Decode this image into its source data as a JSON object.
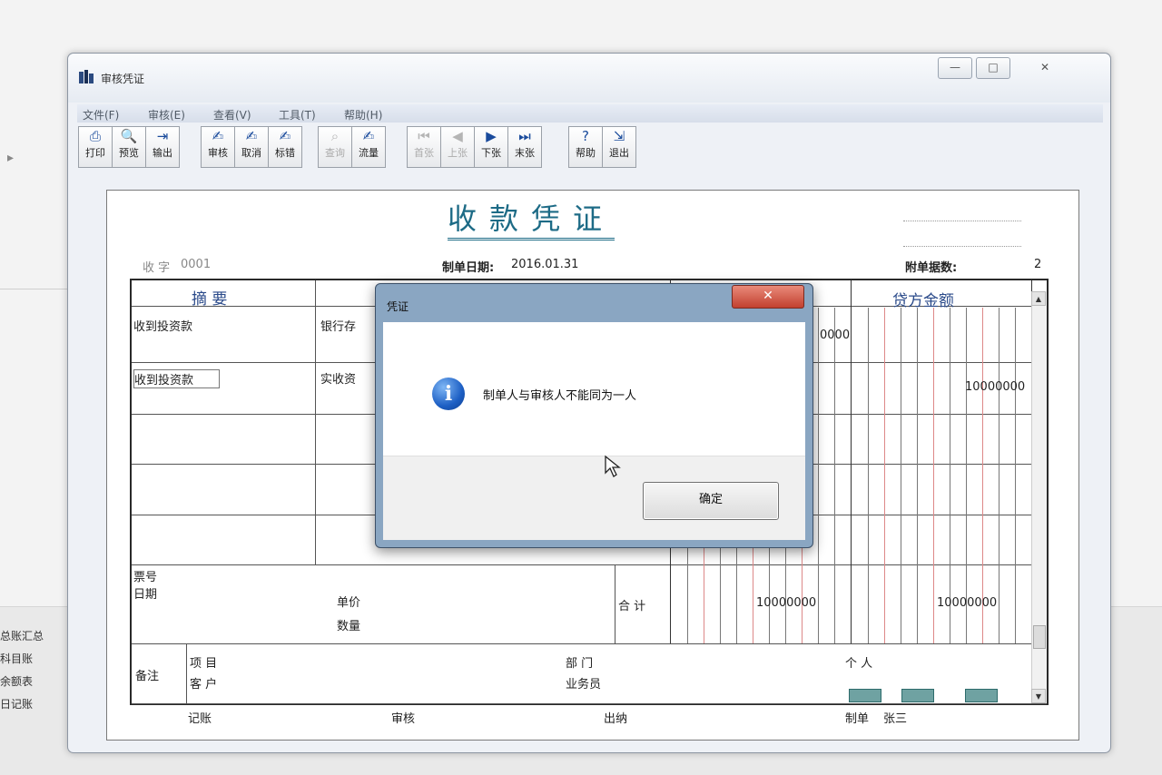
{
  "background": {
    "left_items": [
      "总账汇总",
      "科目账",
      "余额表",
      "日记账"
    ],
    "arrow": "▸"
  },
  "window": {
    "title": "审核凭证",
    "controls": {
      "minimize": "—",
      "maximize": "□",
      "close": "✕"
    },
    "menu": [
      "文件(F)",
      "审核(E)",
      "查看(V)",
      "工具(T)",
      "帮助(H)"
    ],
    "toolbar": [
      {
        "label": "打印",
        "icon": "printer-icon",
        "glyph": "⎙",
        "enabled": true
      },
      {
        "label": "预览",
        "icon": "preview-icon",
        "glyph": "🔍",
        "enabled": true
      },
      {
        "label": "输出",
        "icon": "export-icon",
        "glyph": "⇥",
        "enabled": true
      },
      {
        "label": "审核",
        "icon": "audit-icon",
        "glyph": "✍",
        "enabled": true
      },
      {
        "label": "取消",
        "icon": "cancel-icon",
        "glyph": "✍",
        "enabled": true
      },
      {
        "label": "标错",
        "icon": "mark-error-icon",
        "glyph": "✍",
        "enabled": true
      },
      {
        "label": "查询",
        "icon": "query-icon",
        "glyph": "⌕",
        "enabled": false
      },
      {
        "label": "流量",
        "icon": "flow-icon",
        "glyph": "✍",
        "enabled": true
      },
      {
        "label": "首张",
        "icon": "first-icon",
        "glyph": "⏮",
        "enabled": false
      },
      {
        "label": "上张",
        "icon": "prev-icon",
        "glyph": "◀",
        "enabled": false
      },
      {
        "label": "下张",
        "icon": "next-icon",
        "glyph": "▶",
        "enabled": true
      },
      {
        "label": "末张",
        "icon": "last-icon",
        "glyph": "⏭",
        "enabled": true
      },
      {
        "label": "帮助",
        "icon": "help-icon",
        "glyph": "?",
        "enabled": true
      },
      {
        "label": "退出",
        "icon": "exit-icon",
        "glyph": "⇲",
        "enabled": true
      }
    ]
  },
  "voucher": {
    "title": "收款凭证",
    "type_label": "收 字",
    "number": "0001",
    "date_label": "制单日期:",
    "date": "2016.01.31",
    "attach_label": "附单据数:",
    "attach_count": "2",
    "col_summary": "摘 要",
    "col_credit": "贷方金额",
    "rows": [
      {
        "summary": "收到投资款",
        "account": "银行存",
        "debit": "0000",
        "credit": ""
      },
      {
        "summary": "收到投资款",
        "account": "实收资",
        "debit": "",
        "credit": "10000000"
      }
    ],
    "ticket_no_label": "票号",
    "date_row_label": "日期",
    "unit_price_label": "单价",
    "quantity_label": "数量",
    "total_label": "合 计",
    "total_debit": "10000000",
    "total_credit": "10000000",
    "remark_label": "备注",
    "project_label": "项 目",
    "customer_label": "客 户",
    "department_label": "部 门",
    "salesperson_label": "业务员",
    "person_label": "个 人",
    "bookkeeper_label": "记账",
    "auditor_label": "审核",
    "cashier_label": "出纳",
    "preparer_label": "制单",
    "preparer": "张三"
  },
  "dialog": {
    "title": "凭证",
    "close": "✕",
    "icon": "info-icon",
    "icon_glyph": "i",
    "message": "制单人与审核人不能同为一人",
    "ok": "确定"
  }
}
